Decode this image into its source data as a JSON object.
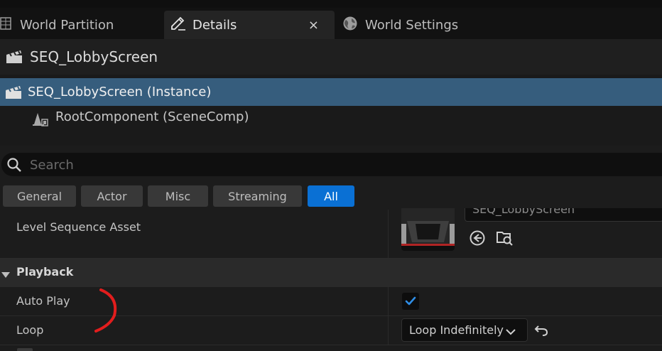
{
  "tabs": [
    {
      "label": "World Partition",
      "icon": "world-partition-grid-icon"
    },
    {
      "label": "Details",
      "icon": "details-pencil-icon",
      "close": "×"
    },
    {
      "label": "World Settings",
      "icon": "world-settings-globe-icon"
    }
  ],
  "actor": {
    "title": "SEQ_LobbyScreen",
    "icon": "clapperboard-icon"
  },
  "tree": [
    {
      "label": "SEQ_LobbyScreen (Instance)",
      "icon": "clapperboard-icon"
    },
    {
      "label": "RootComponent (SceneComp)",
      "icon": "scene-component-icon"
    }
  ],
  "search": {
    "placeholder": "Search"
  },
  "filters": [
    "General",
    "Actor",
    "Misc",
    "Streaming",
    "All"
  ],
  "filters_active": "All",
  "properties": {
    "level_sequence_asset": {
      "name": "Level Sequence Asset",
      "value": "SEQ_LobbyScreen"
    },
    "playback_section": "Playback",
    "auto_play": {
      "name": "Auto Play",
      "checked": true
    },
    "loop": {
      "name": "Loop",
      "value": "Loop Indefinitely"
    }
  },
  "colors": {
    "accent": "#0a70d4",
    "selection": "#365d7d",
    "annotation": "#e21d1d"
  }
}
